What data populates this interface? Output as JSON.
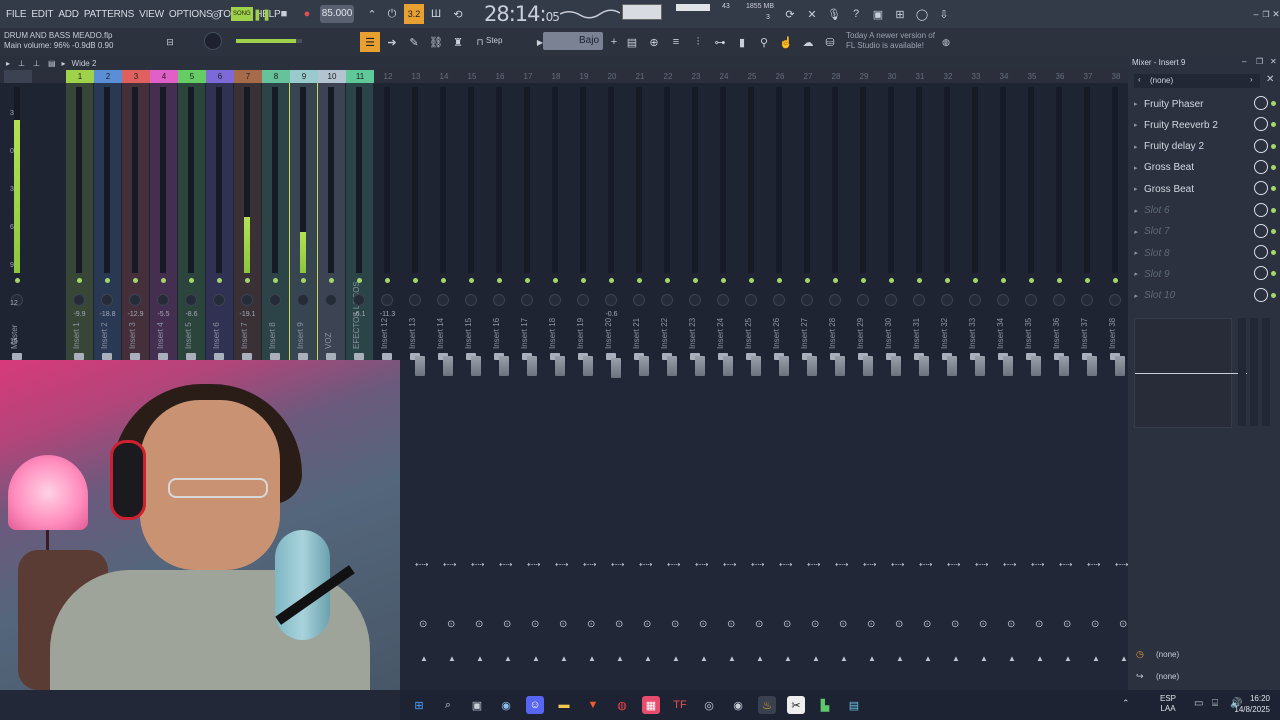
{
  "menu": [
    "FILE",
    "EDIT",
    "ADD",
    "PATTERNS",
    "VIEW",
    "OPTIONS",
    "TOOLS",
    "HELP"
  ],
  "transport": {
    "mode": "SONG",
    "tempo": "85.000",
    "time_main": "28:14",
    "time_sub": "05"
  },
  "system": {
    "memory": "1855 MB",
    "cpu": "43",
    "voices": "3"
  },
  "project": {
    "filename": "DRUM AND BASS MEADO.flp",
    "volume_line": "Main volume: 96%  -0.9dB  0.90"
  },
  "snap": {
    "mode": "Step",
    "preset": "Bajo"
  },
  "notice": {
    "line1": "Today  A newer version of",
    "line2": "FL Studio is available!"
  },
  "mixer_tab": "Wide 2",
  "strip_labels": [
    "Master",
    "Insert 1",
    "Insert 2",
    "Insert 3",
    "Insert 4",
    "Insert 5",
    "Insert 6",
    "Insert 7",
    "Insert 8",
    "Insert 9",
    "VOZ",
    "EFECTOS LOCOS",
    "Insert 12",
    "Insert 13",
    "Insert 14",
    "Insert 15",
    "Insert 16",
    "Insert 17",
    "Insert 18",
    "Insert 19",
    "Insert 20",
    "Insert 21",
    "Insert 22",
    "Insert 23",
    "Insert 24",
    "Insert 25",
    "Insert 26",
    "Insert 27",
    "Insert 28",
    "Insert 29",
    "Insert 30",
    "Insert 31",
    "Insert 32",
    "Insert 33",
    "Insert 34",
    "Insert 35",
    "Insert 36",
    "Insert 37",
    "Insert 38"
  ],
  "strip_numbers": [
    "",
    "1",
    "2",
    "3",
    "4",
    "5",
    "6",
    "7",
    "8",
    "9",
    "10",
    "11",
    "12",
    "13",
    "14",
    "15",
    "16",
    "17",
    "18",
    "19",
    "20",
    "21",
    "22",
    "23",
    "24",
    "25",
    "26",
    "27",
    "28",
    "29",
    "30",
    "31",
    "32",
    "33",
    "34",
    "35",
    "36",
    "37",
    "38"
  ],
  "strip_colors": [
    "#3c4252",
    "#9fd24a",
    "#5a8fd8",
    "#e06060",
    "#e060c8",
    "#66cc66",
    "#7c6ad8",
    "#a86b4a",
    "#66c29a",
    "#9acbcc",
    "#b4c3d0",
    "#5fc99a"
  ],
  "strip_volumes": [
    "",
    "-9.9",
    "-18.8",
    "-12.9",
    "-5.5",
    "-8.6",
    "",
    "-19.1",
    "",
    "",
    "",
    "-6.1",
    "-11.3",
    "",
    "",
    "",
    "",
    "",
    "",
    "",
    "-0.6"
  ],
  "strip_levels": [
    0.82,
    0,
    0,
    0,
    0,
    0,
    0,
    0.3,
    0,
    0.22,
    0,
    0,
    0
  ],
  "db_scale": [
    "3",
    "0",
    "3",
    "6",
    "9",
    "12",
    "15"
  ],
  "mixer_panel": {
    "title": "Mixer - Insert 9",
    "input": "(none)",
    "slots": [
      "Fruity Phaser",
      "Fruity Reeverb 2",
      "Fruity delay 2",
      "Gross Beat",
      "Gross Beat",
      "Slot 6",
      "Slot 7",
      "Slot 8",
      "Slot 9",
      "Slot 10"
    ],
    "slot_active": [
      true,
      true,
      true,
      true,
      true,
      false,
      false,
      false,
      false,
      false
    ],
    "output_top": "(none)",
    "output_bottom": "(none)"
  },
  "taskbar": {
    "lang_line1": "ESP",
    "lang_line2": "LAA",
    "time": "16:20",
    "date": "14/8/2025"
  }
}
